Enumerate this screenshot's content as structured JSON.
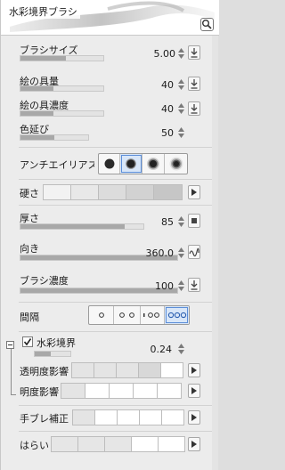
{
  "header": {
    "title": "水彩境界ブラシ",
    "preview_button_icon": "magnifier-icon"
  },
  "rows": {
    "brush_size": {
      "label": "ブラシサイズ",
      "value": "5.00",
      "fill": 0.55
    },
    "paint_amount": {
      "label": "絵の具量",
      "value": "40",
      "fill": 0.4
    },
    "paint_density": {
      "label": "絵の具濃度",
      "value": "40",
      "fill": 0.4
    },
    "color_stretch": {
      "label": "色延び",
      "value": "50",
      "fill": 0.5
    },
    "antialias": {
      "label": "アンチエイリアス",
      "options": [
        "none",
        "weak",
        "medium",
        "strong"
      ],
      "selected": 1
    },
    "hardness": {
      "label": "硬さ",
      "swatches": 5
    },
    "thickness": {
      "label": "厚さ",
      "value": "85",
      "fill": 0.85
    },
    "direction": {
      "label": "向き",
      "value": "360.0",
      "fill": 1.0
    },
    "brush_density": {
      "label": "ブラシ濃度",
      "value": "100",
      "fill": 1.0
    },
    "spacing": {
      "label": "間隔",
      "options": [
        "narrow",
        "normal",
        "wide",
        "fixed"
      ],
      "selected": 3
    },
    "watercolor_edge": {
      "label": "水彩境界",
      "value": "0.24",
      "fill": 0.24,
      "checked": true
    },
    "opacity_effect": {
      "label": "透明度影響",
      "swatches": 5
    },
    "brightness_effect": {
      "label": "明度影響",
      "swatches": 5
    },
    "stabilization": {
      "label": "手ブレ補正",
      "swatches": 5
    },
    "taper": {
      "label": "はらい",
      "swatches": 5
    }
  },
  "colors": {
    "panel_bg": "#ececec",
    "accent": "#5c8ed8"
  }
}
